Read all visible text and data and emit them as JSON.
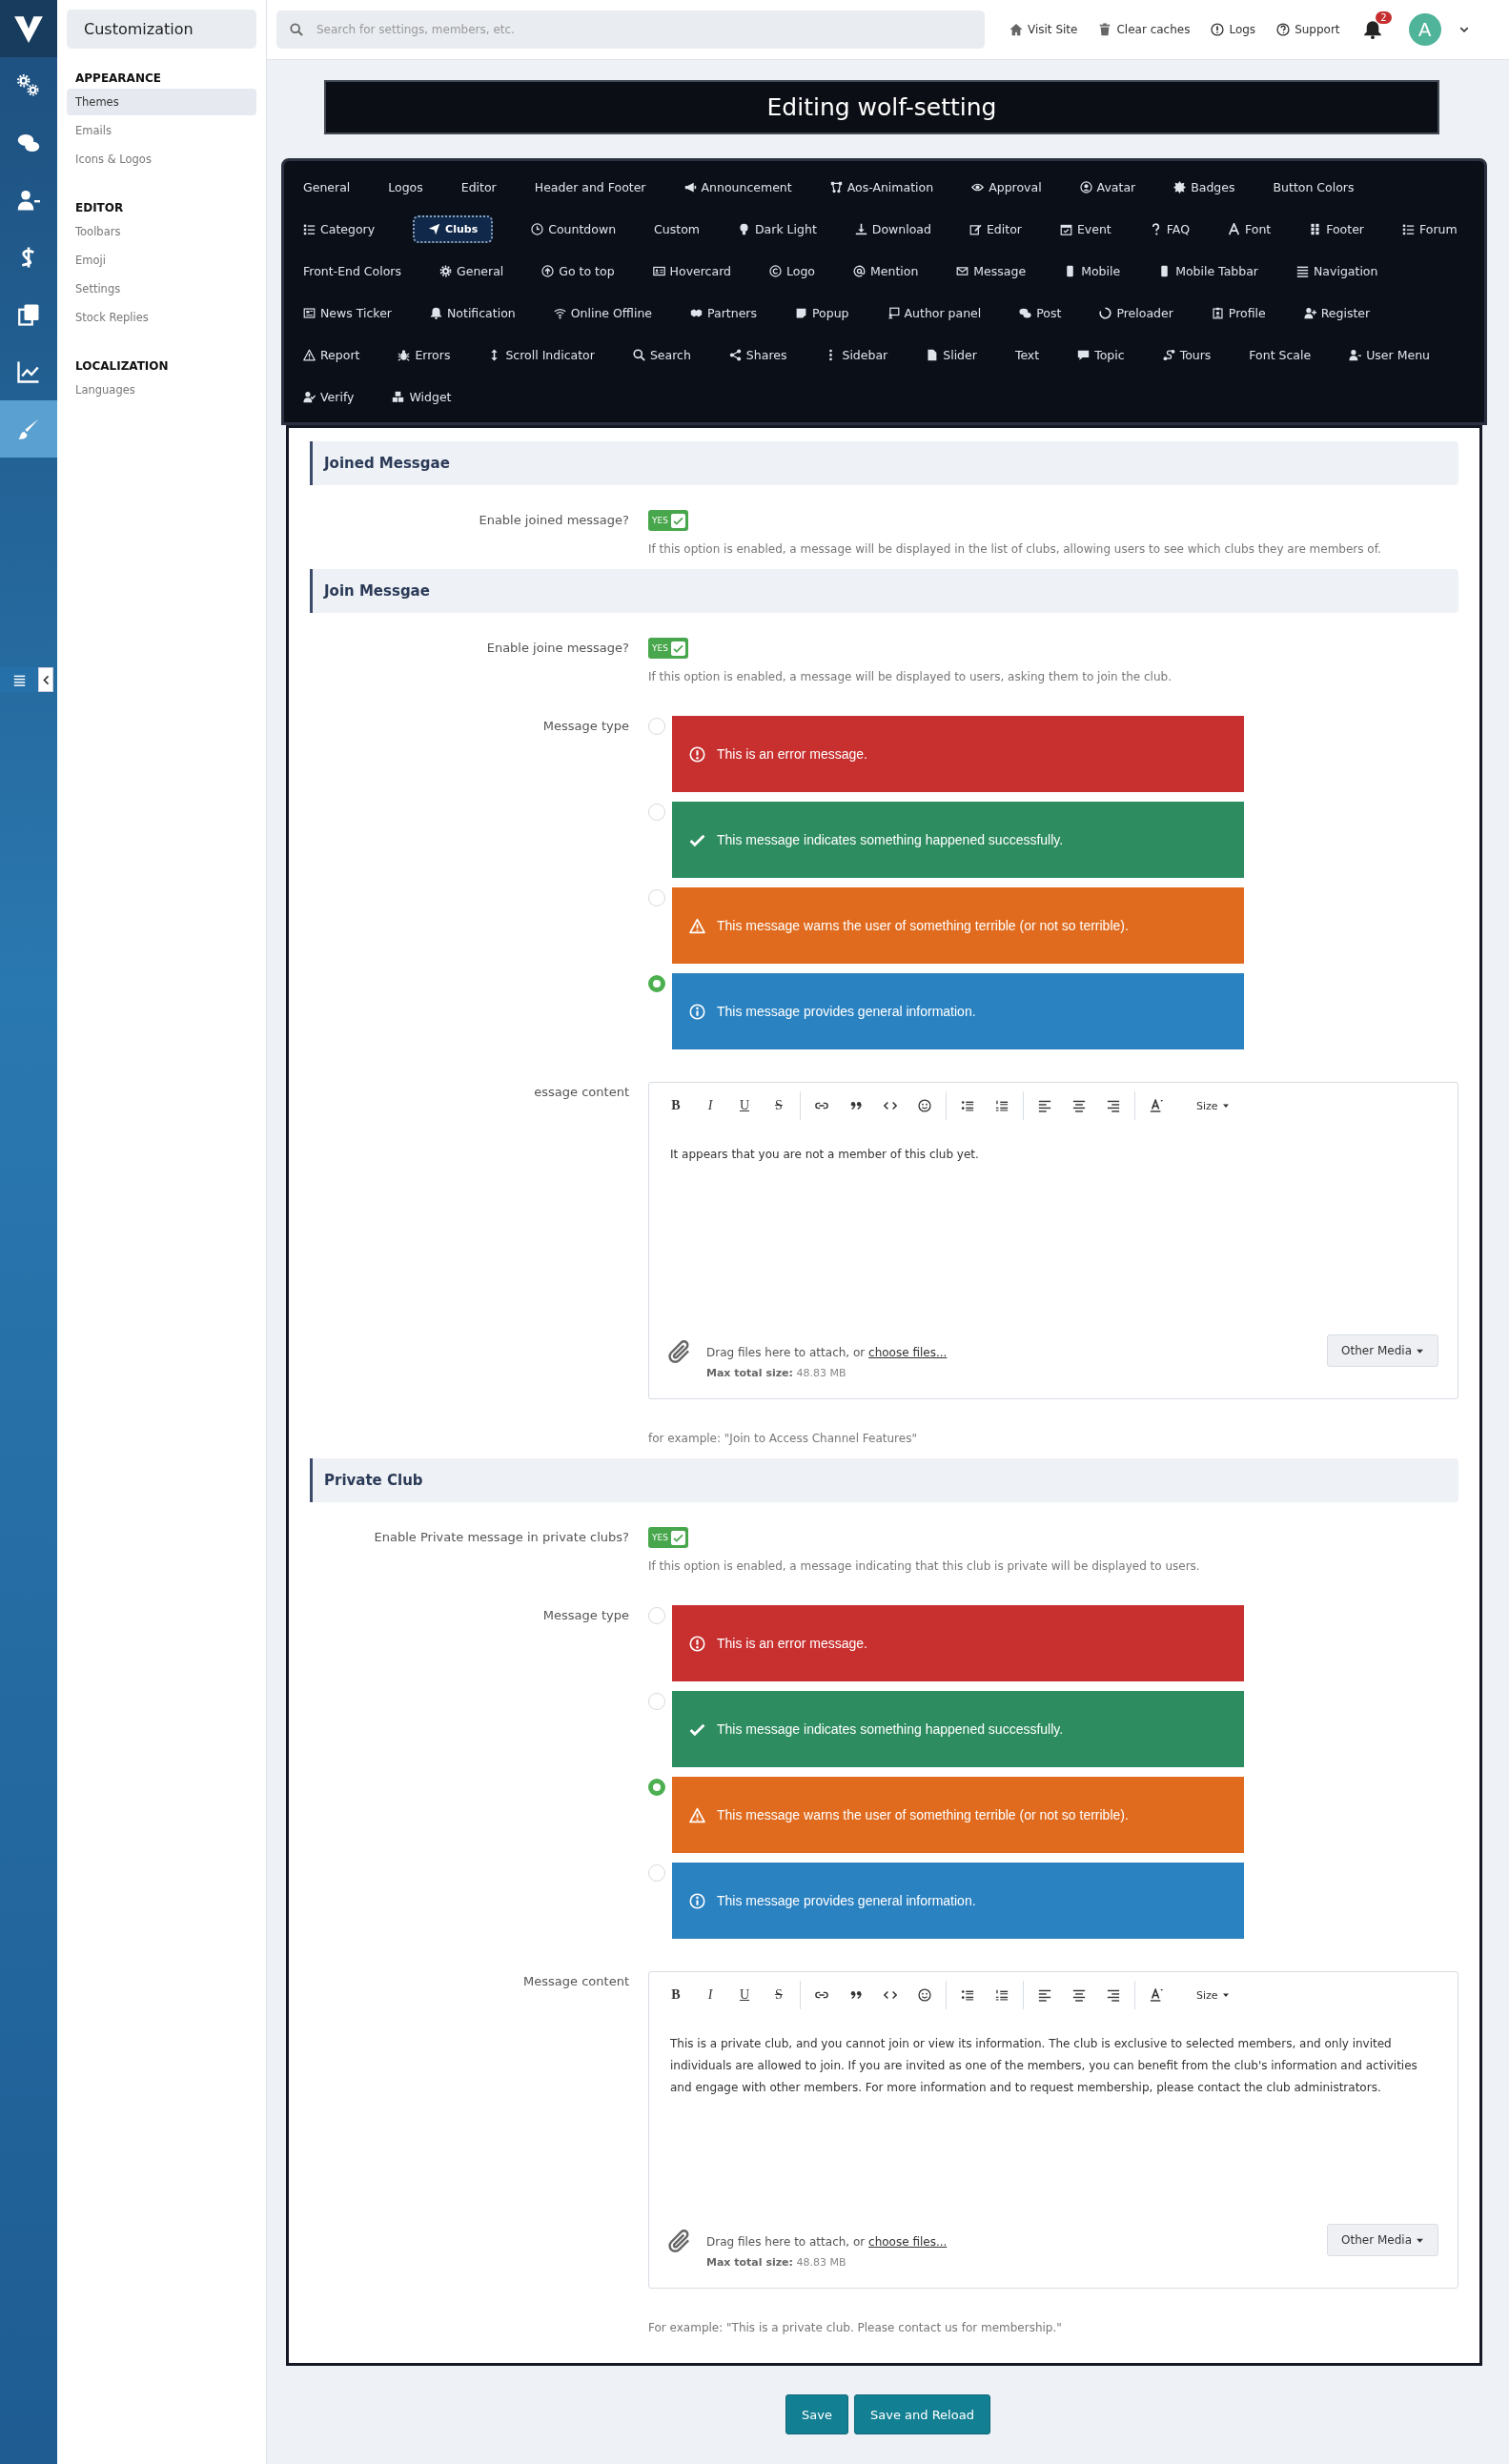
{
  "rail": {
    "items": [
      {
        "selected": false
      },
      {
        "selected": false
      },
      {
        "selected": false
      },
      {
        "selected": false
      },
      {
        "selected": false
      },
      {
        "selected": false
      },
      {
        "selected": true
      }
    ]
  },
  "sidebar": {
    "title": "Customization",
    "groups": [
      {
        "heading": "APPEARANCE",
        "items": [
          {
            "label": "Themes",
            "selected": true
          },
          {
            "label": "Emails",
            "selected": false
          },
          {
            "label": "Icons & Logos",
            "selected": false
          }
        ]
      },
      {
        "heading": "EDITOR",
        "items": [
          {
            "label": "Toolbars",
            "selected": false
          },
          {
            "label": "Emoji",
            "selected": false
          },
          {
            "label": "Settings",
            "selected": false
          },
          {
            "label": "Stock Replies",
            "selected": false
          }
        ]
      },
      {
        "heading": "LOCALIZATION",
        "items": [
          {
            "label": "Languages",
            "selected": false
          }
        ]
      }
    ]
  },
  "header": {
    "search": {
      "placeholder": "Search for settings, members, etc."
    },
    "links": [
      "Visit Site",
      "Clear caches",
      "Logs",
      "Support"
    ],
    "notification_count": "2",
    "avatar_letter": "A"
  },
  "page_title": "Editing wolf-setting",
  "tab_rows": [
    [
      {
        "label": "General",
        "selected": false
      },
      {
        "label": "Logos",
        "selected": false
      },
      {
        "label": "Editor",
        "selected": false
      },
      {
        "label": "Header and Footer",
        "selected": false
      },
      {
        "label": "Announcement",
        "selected": false
      },
      {
        "label": "Aos-Animation",
        "selected": false
      },
      {
        "label": "Approval",
        "selected": false
      },
      {
        "label": "Avatar",
        "selected": false
      },
      {
        "label": "Badges",
        "selected": false
      },
      {
        "label": "Button Colors",
        "selected": false
      }
    ],
    [
      {
        "label": "Category",
        "selected": false
      },
      {
        "label": "Clubs",
        "selected": true
      },
      {
        "label": "Countdown",
        "selected": false
      },
      {
        "label": "Custom",
        "selected": false
      },
      {
        "label": "Dark Light",
        "selected": false
      },
      {
        "label": "Download",
        "selected": false
      },
      {
        "label": "Editor",
        "selected": false
      },
      {
        "label": "Event",
        "selected": false
      },
      {
        "label": "FAQ",
        "selected": false
      },
      {
        "label": "Font",
        "selected": false
      },
      {
        "label": "Footer",
        "selected": false
      },
      {
        "label": "Forum",
        "selected": false
      }
    ],
    [
      {
        "label": "Front-End Colors",
        "selected": false
      },
      {
        "label": "General",
        "selected": false
      },
      {
        "label": "Go to top",
        "selected": false
      },
      {
        "label": "Hovercard",
        "selected": false
      },
      {
        "label": "Logo",
        "selected": false
      },
      {
        "label": "Mention",
        "selected": false
      },
      {
        "label": "Message",
        "selected": false
      },
      {
        "label": "Mobile",
        "selected": false
      },
      {
        "label": "Mobile Tabbar",
        "selected": false
      },
      {
        "label": "Navigation",
        "selected": false
      }
    ],
    [
      {
        "label": "News Ticker",
        "selected": false
      },
      {
        "label": "Notification",
        "selected": false
      },
      {
        "label": "Online Offline",
        "selected": false
      },
      {
        "label": "Partners",
        "selected": false
      },
      {
        "label": "Popup",
        "selected": false
      },
      {
        "label": "Author panel",
        "selected": false
      },
      {
        "label": "Post",
        "selected": false
      },
      {
        "label": "Preloader",
        "selected": false
      },
      {
        "label": "Profile",
        "selected": false
      },
      {
        "label": "Register",
        "selected": false
      }
    ],
    [
      {
        "label": "Report",
        "selected": false
      },
      {
        "label": "Errors",
        "selected": false
      },
      {
        "label": "Scroll Indicator",
        "selected": false
      },
      {
        "label": "Search",
        "selected": false
      },
      {
        "label": "Shares",
        "selected": false
      },
      {
        "label": "Sidebar",
        "selected": false
      },
      {
        "label": "Slider",
        "selected": false
      },
      {
        "label": "Text",
        "selected": false
      },
      {
        "label": "Topic",
        "selected": false
      },
      {
        "label": "Tours",
        "selected": false
      },
      {
        "label": "Font Scale",
        "selected": false
      },
      {
        "label": "User Menu",
        "selected": false
      }
    ],
    [
      {
        "label": "Verify",
        "selected": false
      },
      {
        "label": "Widget",
        "selected": false
      }
    ]
  ],
  "sections": [
    {
      "title": "Joined Messgae",
      "rows": [
        {
          "kind": "toggle",
          "label": "Enable joined message?",
          "toggle_text": "YES",
          "on": true,
          "hint": "If this option is enabled, a message will be displayed in the list of clubs, allowing users to see which clubs they are members of."
        }
      ]
    },
    {
      "title": "Join Messgae",
      "rows": [
        {
          "kind": "toggle",
          "label": "Enable joine message?",
          "toggle_text": "YES",
          "on": true,
          "hint": "If this option is enabled, a message will be displayed to users, asking them to join the club."
        },
        {
          "kind": "message_type",
          "label": "Message type",
          "options": [
            {
              "kind": "error",
              "text": "This is an error message.",
              "selected": false
            },
            {
              "kind": "success",
              "text": "This message indicates something happened successfully.",
              "selected": false
            },
            {
              "kind": "warning",
              "text": "This message warns the user of something terrible (or not so terrible).",
              "selected": false
            },
            {
              "kind": "info",
              "text": "This message provides general information.",
              "selected": true
            }
          ]
        },
        {
          "kind": "editor",
          "label": "essage content",
          "toolbar_letters": [
            "B",
            "I",
            "U",
            "S"
          ],
          "size_label": "Size",
          "content": "It appears that you are not a member of this club yet.",
          "attach_text": "Drag files here to attach, or ",
          "attach_link": "choose files...",
          "max_size": "**Max total size:** 48.83 MB",
          "media_button": "Other Media",
          "hint": "for example: \"Join to Access Channel Features\""
        }
      ]
    },
    {
      "title": "Private Club",
      "rows": [
        {
          "kind": "toggle",
          "label": "Enable Private message in private clubs?",
          "toggle_text": "YES",
          "on": true,
          "hint": "If this option is enabled, a message indicating that this club is private will be displayed to users."
        },
        {
          "kind": "message_type",
          "label": "Message type",
          "options": [
            {
              "kind": "error",
              "text": "This is an error message.",
              "selected": false
            },
            {
              "kind": "success",
              "text": "This message indicates something happened successfully.",
              "selected": false
            },
            {
              "kind": "warning",
              "text": "This message warns the user of something terrible (or not so terrible).",
              "selected": true
            },
            {
              "kind": "info",
              "text": "This message provides general information.",
              "selected": false
            }
          ]
        },
        {
          "kind": "editor",
          "label": "Message content",
          "toolbar_letters": [
            "B",
            "I",
            "U",
            "S"
          ],
          "size_label": "Size",
          "content": "This is a private club, and you cannot join or view its information. The club is exclusive to selected members, and only invited individuals are allowed to join. If you are invited as one of the members, you can benefit from the club's information and activities and engage with other members. For more information and to request membership, please contact the club administrators.",
          "attach_text": "Drag files here to attach, or ",
          "attach_link": "choose files...",
          "max_size": "**Max total size:** 48.83 MB",
          "media_button": "Other Media",
          "hint": "For example: \"This is a private club. Please contact us for membership.\""
        }
      ]
    }
  ],
  "buttons": [
    "Save",
    "Save and Reload"
  ]
}
